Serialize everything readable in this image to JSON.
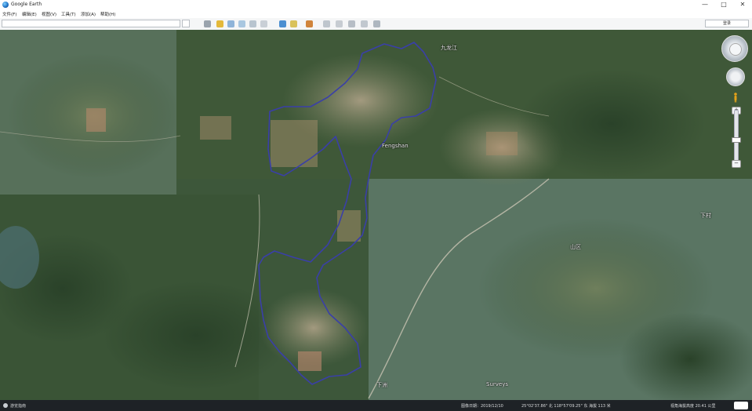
{
  "window": {
    "title": "Google Earth",
    "controls": {
      "minimize": "—",
      "maximize": "□",
      "close": "✕"
    }
  },
  "menu": {
    "items": [
      "文件(F)",
      "编辑(E)",
      "视图(V)",
      "工具(T)",
      "添加(A)",
      "帮助(H)"
    ]
  },
  "toolbar": {
    "search_placeholder": "",
    "signin_label": "登录",
    "tools": [
      "hide-sidebar-icon",
      "placemark-icon",
      "polygon-icon",
      "path-icon",
      "image-overlay-icon",
      "record-tour-icon",
      "historical-imagery-icon",
      "sun-icon",
      "planets-icon",
      "ruler-icon",
      "email-icon",
      "print-icon",
      "save-image-icon",
      "view-in-maps-icon"
    ]
  },
  "map": {
    "labels": [
      {
        "id": "label-top",
        "text": "九龙江"
      },
      {
        "id": "label-center",
        "text": "Fengshan"
      },
      {
        "id": "label-right",
        "text": "下村"
      },
      {
        "id": "label-mid-right",
        "text": "山区"
      },
      {
        "id": "label-bottom",
        "text": "下洲"
      },
      {
        "id": "label-bottom-right",
        "text": "Surveys"
      }
    ],
    "boundary_color": "#3a3fa8"
  },
  "status": {
    "tour_label": "游览指南",
    "imagery_date": "图像日期：2019/12/10",
    "coordinates": "25°02'37.86\" 北  118°57'09.25\" 东  海拔 113 米",
    "eye_alt": "视角海拔高度 20.41 公里"
  }
}
